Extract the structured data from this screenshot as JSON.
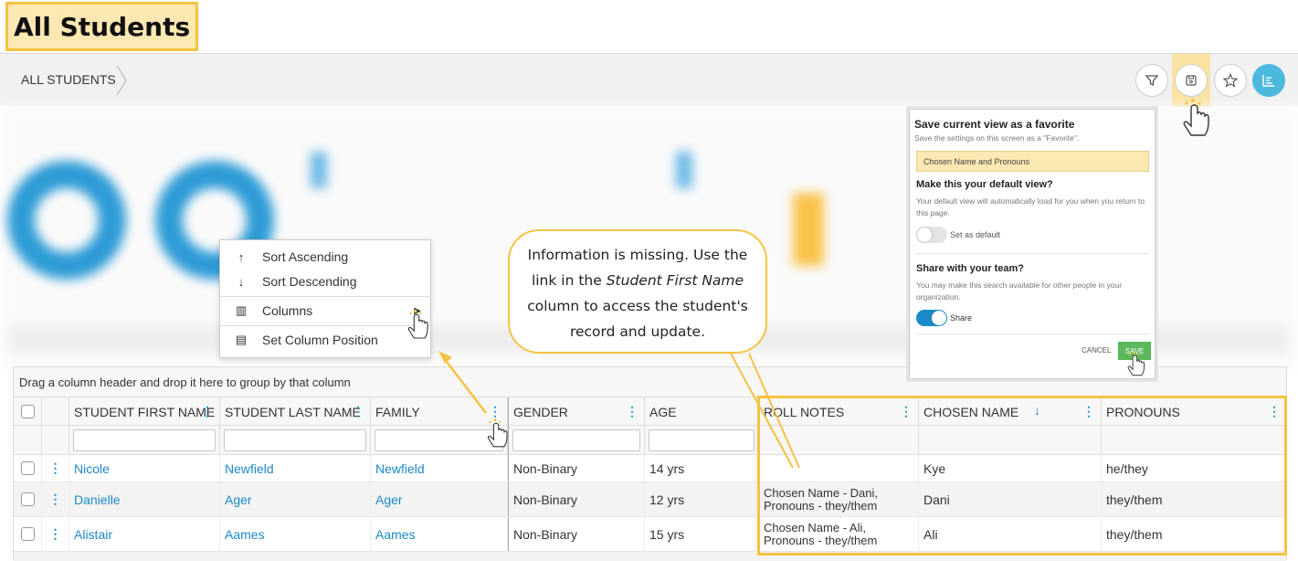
{
  "page": {
    "title": "All Students"
  },
  "breadcrumb": {
    "label": "ALL STUDENTS"
  },
  "toolbar": {
    "icons": [
      "filter-icon",
      "save-icon",
      "star-icon",
      "chart-icon"
    ]
  },
  "context_menu": {
    "sort_asc": "Sort Ascending",
    "sort_desc": "Sort Descending",
    "columns": "Columns",
    "set_position": "Set Column Position"
  },
  "callout": {
    "line1": "Information is missing. Use the",
    "line2_pre": "link in the ",
    "line2_em": "Student First Name",
    "line3": "column to access the student's",
    "line4": "record and update."
  },
  "favorite_panel": {
    "title": "Save current view as a favorite",
    "subtitle": "Save the settings on this screen as a \"Favorite\".",
    "name_value": "Chosen Name and Pronouns",
    "default_heading": "Make this your default view?",
    "default_desc": "Your default view will automatically load for you when you return to this page.",
    "default_toggle_label": "Set as default",
    "share_heading": "Share with your team?",
    "share_desc": "You may make this search available for other people in your organization.",
    "share_toggle_label": "Share",
    "cancel_label": "CANCEL",
    "save_label": "SAVE"
  },
  "grid": {
    "group_hint": "Drag a column header and drop it here to group by that column",
    "columns": [
      "STUDENT FIRST NAME",
      "STUDENT LAST NAME",
      "FAMILY",
      "GENDER",
      "AGE",
      "ROLL NOTES",
      "CHOSEN NAME",
      "PRONOUNS"
    ],
    "rows": [
      {
        "first": "Nicole",
        "last": "Newfield",
        "family": "Newfield",
        "gender": "Non-Binary",
        "age": "14 yrs",
        "notes1": "",
        "notes2": "",
        "chosen": "Kye",
        "pronouns": "he/they"
      },
      {
        "first": "Danielle",
        "last": "Ager",
        "family": "Ager",
        "gender": "Non-Binary",
        "age": "12 yrs",
        "notes1": "Chosen Name - Dani,",
        "notes2": "Pronouns - they/them",
        "chosen": "Dani",
        "pronouns": "they/them"
      },
      {
        "first": "Alistair",
        "last": "Aames",
        "family": "Aames",
        "gender": "Non-Binary",
        "age": "15 yrs",
        "notes1": "Chosen Name - Ali,",
        "notes2": "Pronouns - they/them",
        "chosen": "Ali",
        "pronouns": "they/them"
      }
    ]
  },
  "colors": {
    "accent": "#1b8ac7",
    "highlight": "#f5c242",
    "save_green": "#5cb85c",
    "toggle_on": "#1b8ac7"
  }
}
